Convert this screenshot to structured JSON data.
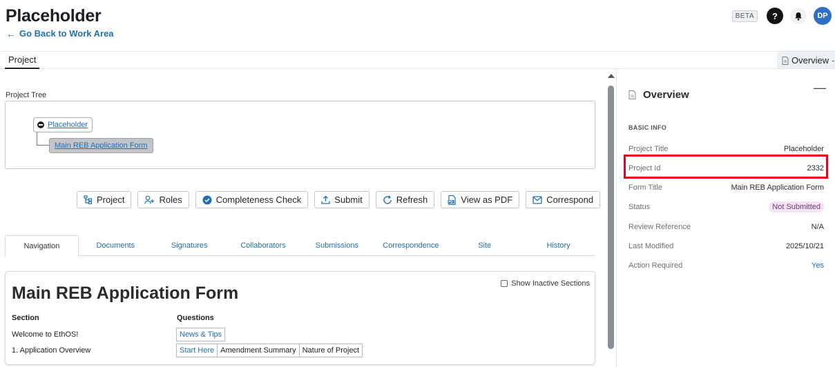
{
  "header": {
    "title": "Placeholder",
    "back_link": "Go Back to Work Area",
    "beta_label": "BETA",
    "help_glyph": "?",
    "avatar_initials": "DP"
  },
  "top_tabs": {
    "project": "Project",
    "overview": "Overview"
  },
  "project_tree": {
    "label": "Project Tree",
    "root": "Placeholder",
    "child": "Main REB Application Form"
  },
  "actions": [
    {
      "label": "Project",
      "icon": "project-tree-icon"
    },
    {
      "label": "Roles",
      "icon": "user-add-icon"
    },
    {
      "label": "Completeness Check",
      "icon": "check-circle-icon"
    },
    {
      "label": "Submit",
      "icon": "upload-icon"
    },
    {
      "label": "Refresh",
      "icon": "refresh-icon"
    },
    {
      "label": "View as PDF",
      "icon": "pdf-icon"
    },
    {
      "label": "Correspond",
      "icon": "mail-icon"
    }
  ],
  "sub_tabs": [
    "Navigation",
    "Documents",
    "Signatures",
    "Collaborators",
    "Submissions",
    "Correspondence",
    "Site",
    "History"
  ],
  "form": {
    "title": "Main REB Application Form",
    "show_inactive": "Show Inactive Sections",
    "col_section": "Section",
    "col_questions": "Questions",
    "rows": [
      {
        "section": "Welcome to EthOS!",
        "questions": [
          "News & Tips"
        ]
      },
      {
        "section": "1. Application Overview",
        "questions": [
          "Start Here",
          "Amendment Summary",
          "Nature of Project"
        ]
      }
    ]
  },
  "overview": {
    "title": "Overview",
    "collapse_glyph": "—",
    "section_label": "BASIC INFO",
    "rows": [
      {
        "key": "Project Title",
        "value": "Placeholder"
      },
      {
        "key": "Project Id",
        "value": "2332"
      },
      {
        "key": "Form Title",
        "value": "Main REB Application Form"
      },
      {
        "key": "Status",
        "value": "Not Submitted"
      },
      {
        "key": "Review Reference",
        "value": "N/A"
      },
      {
        "key": "Last Modified",
        "value": "2025/10/21"
      },
      {
        "key": "Action Required",
        "value": "Yes"
      }
    ]
  },
  "colors": {
    "link": "#1f6fb5",
    "highlight": "#e1081c",
    "avatar": "#2f6ec4",
    "status_pill_bg": "#f3e3f4"
  }
}
